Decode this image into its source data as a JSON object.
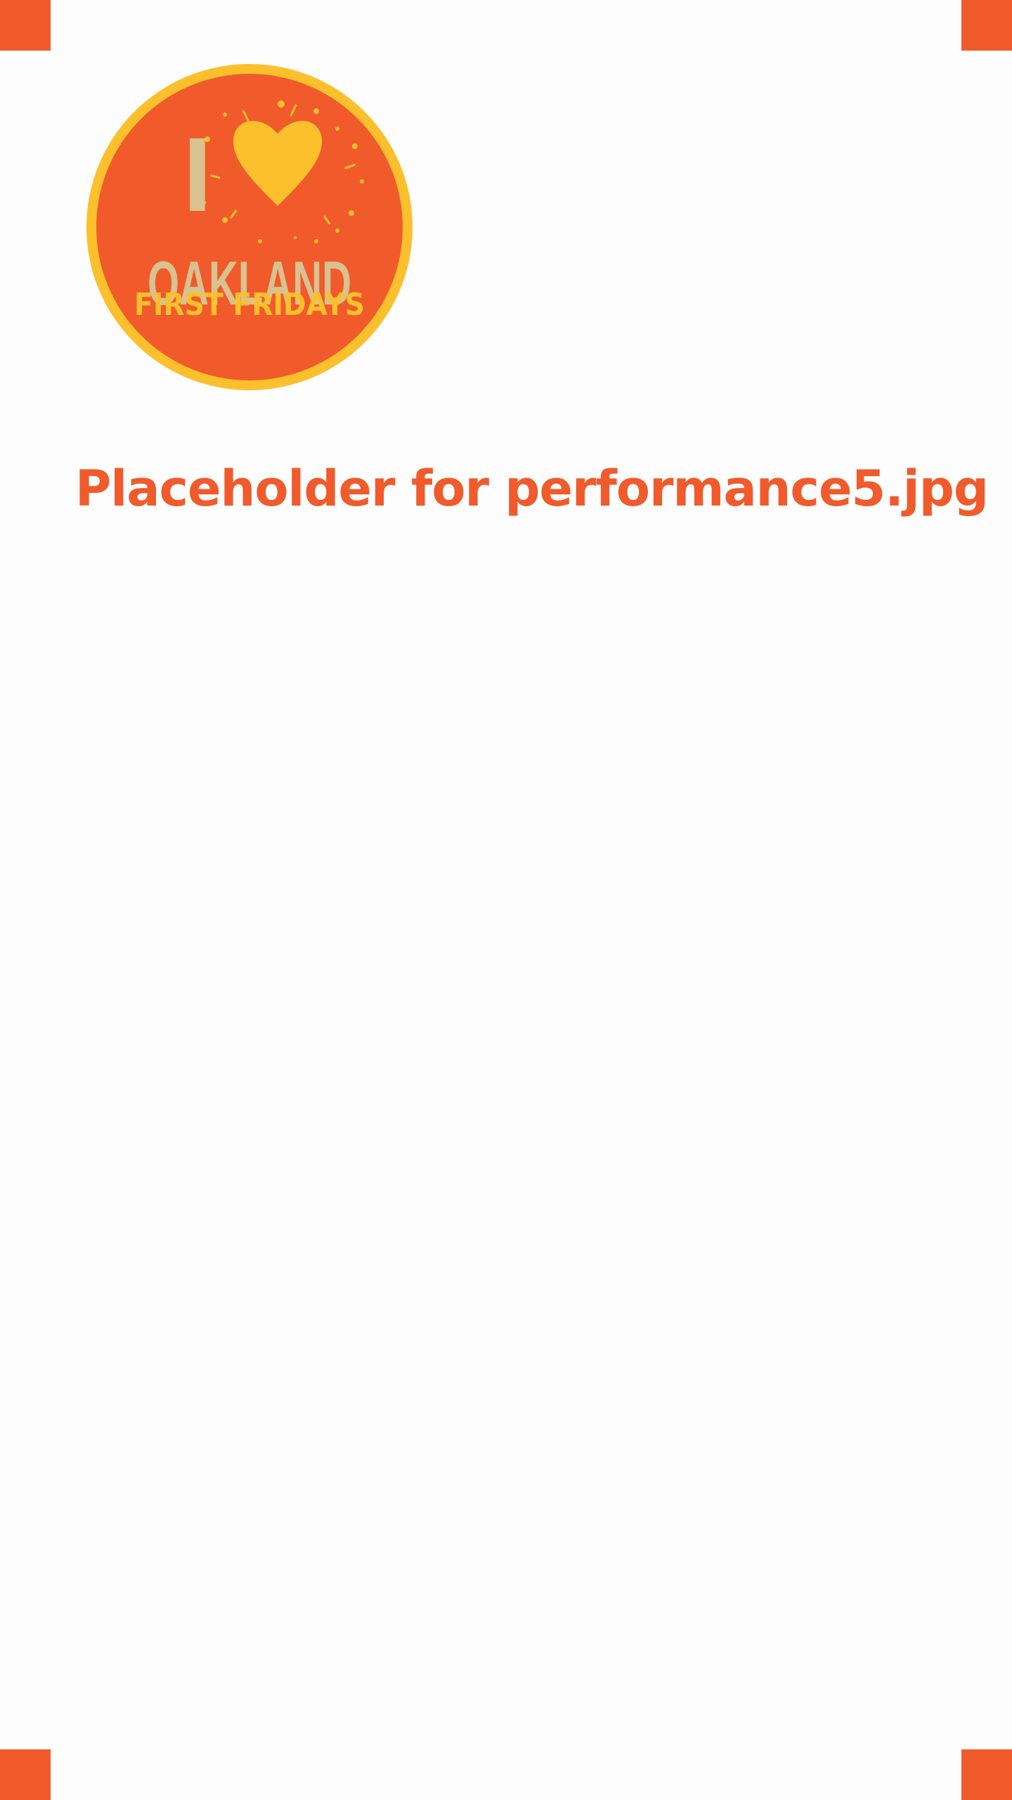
{
  "colors": {
    "accent": "#f15a2b",
    "gold": "#fcc02c",
    "tan": "#d8c28f",
    "background": "#fdfdfd"
  },
  "logo": {
    "letter": "I",
    "word": "OAKLAND",
    "tagline": "FIRST FRIDAYS",
    "heart_icon": "heart-icon"
  },
  "main": {
    "placeholder_text": "Placeholder for performance5.jpg"
  }
}
